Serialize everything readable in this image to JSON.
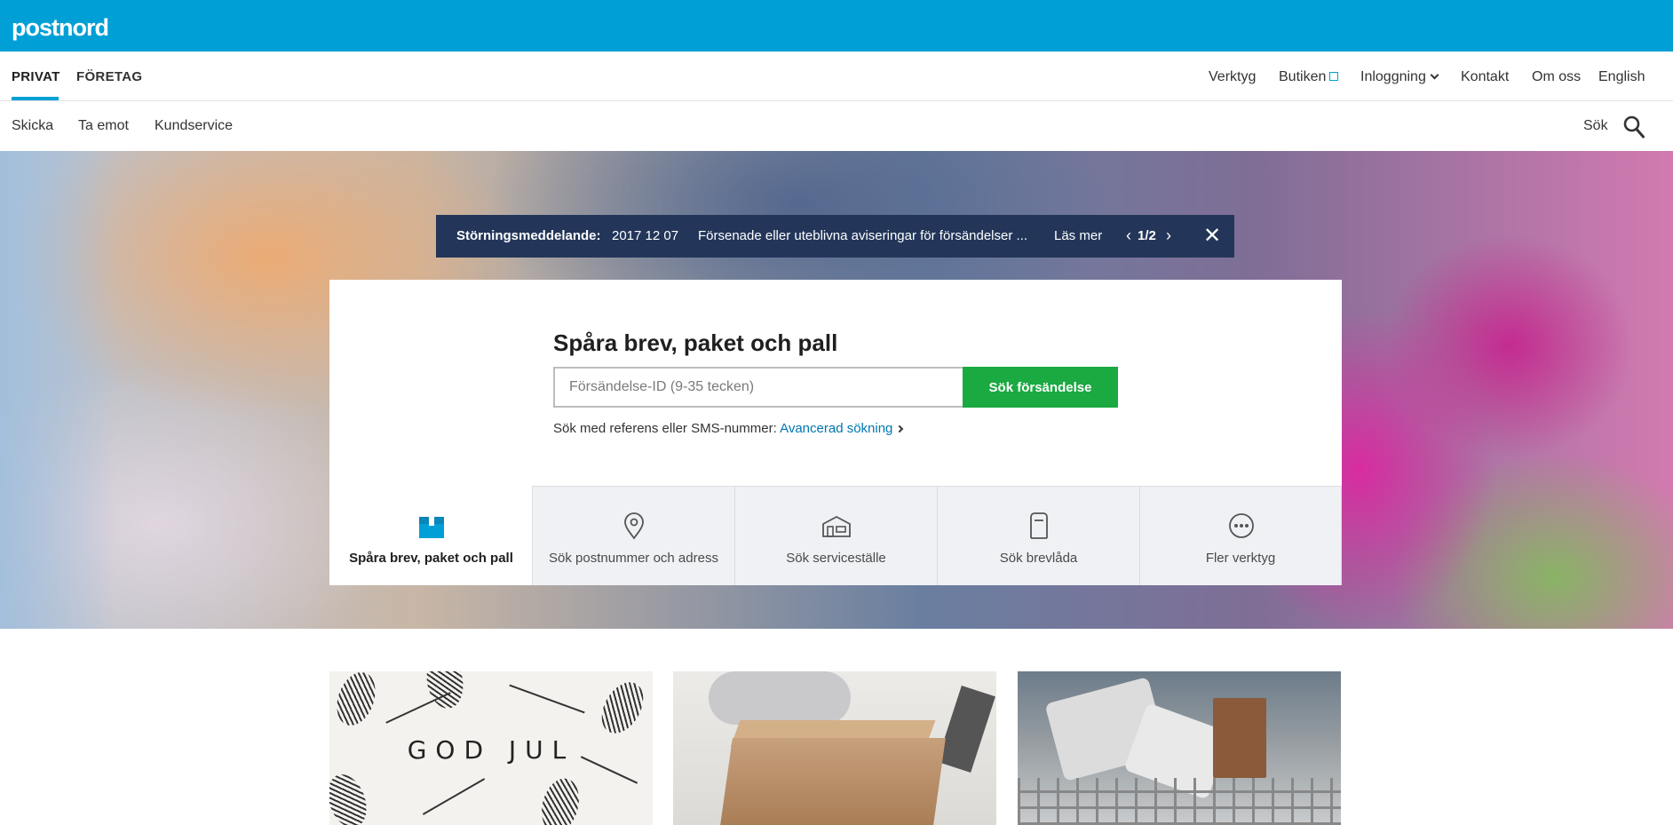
{
  "brand": {
    "logo_text": "postnord",
    "color": "#00a0d6"
  },
  "primary_nav": {
    "segments": [
      {
        "label": "PRIVAT",
        "active": true
      },
      {
        "label": "FÖRETAG",
        "active": false
      }
    ],
    "utility_links": [
      {
        "label": "Verktyg"
      },
      {
        "label": "Butiken",
        "icon": "external-link-icon"
      },
      {
        "label": "Inloggning",
        "icon": "chevron-down-icon"
      },
      {
        "label": "Kontakt"
      },
      {
        "label": "Om oss"
      },
      {
        "label": "English"
      }
    ]
  },
  "secondary_nav": {
    "links": [
      {
        "label": "Skicka"
      },
      {
        "label": "Ta emot"
      },
      {
        "label": "Kundservice"
      }
    ],
    "search_label": "Sök",
    "search_icon": "search-icon"
  },
  "alert": {
    "title": "Störningsmeddelande:",
    "date": "2017 12 07",
    "text": "Försenade eller uteblivna aviseringar för försändelser ...",
    "read_more": "Läs mer",
    "pager": "1/2",
    "prev_symbol": "‹",
    "next_symbol": "›",
    "close_symbol": "✕",
    "bg_color": "#23365a"
  },
  "tracking": {
    "title": "Spåra brev, paket och pall",
    "input_placeholder": "Försändelse-ID (9-35 tecken)",
    "input_value": "",
    "button_label": "Sök försändelse",
    "button_color": "#1ba942",
    "advanced_prefix": "Sök med referens eller SMS-nummer:",
    "advanced_link": "Avancerad sökning"
  },
  "tools": [
    {
      "label": "Spåra brev, paket och pall",
      "icon": "parcel-box-icon",
      "active": true
    },
    {
      "label": "Sök postnummer och adress",
      "icon": "location-pin-icon",
      "active": false
    },
    {
      "label": "Sök serviceställe",
      "icon": "service-point-icon",
      "active": false
    },
    {
      "label": "Sök brevlåda",
      "icon": "mailbox-icon",
      "active": false
    },
    {
      "label": "Fler verktyg",
      "icon": "more-dots-icon",
      "active": false
    }
  ],
  "tiles": [
    {
      "image": "god-jul-card",
      "caption_in_image": "GOD JUL"
    },
    {
      "image": "parcel-on-desk"
    },
    {
      "image": "mail-sorting-cart"
    }
  ]
}
